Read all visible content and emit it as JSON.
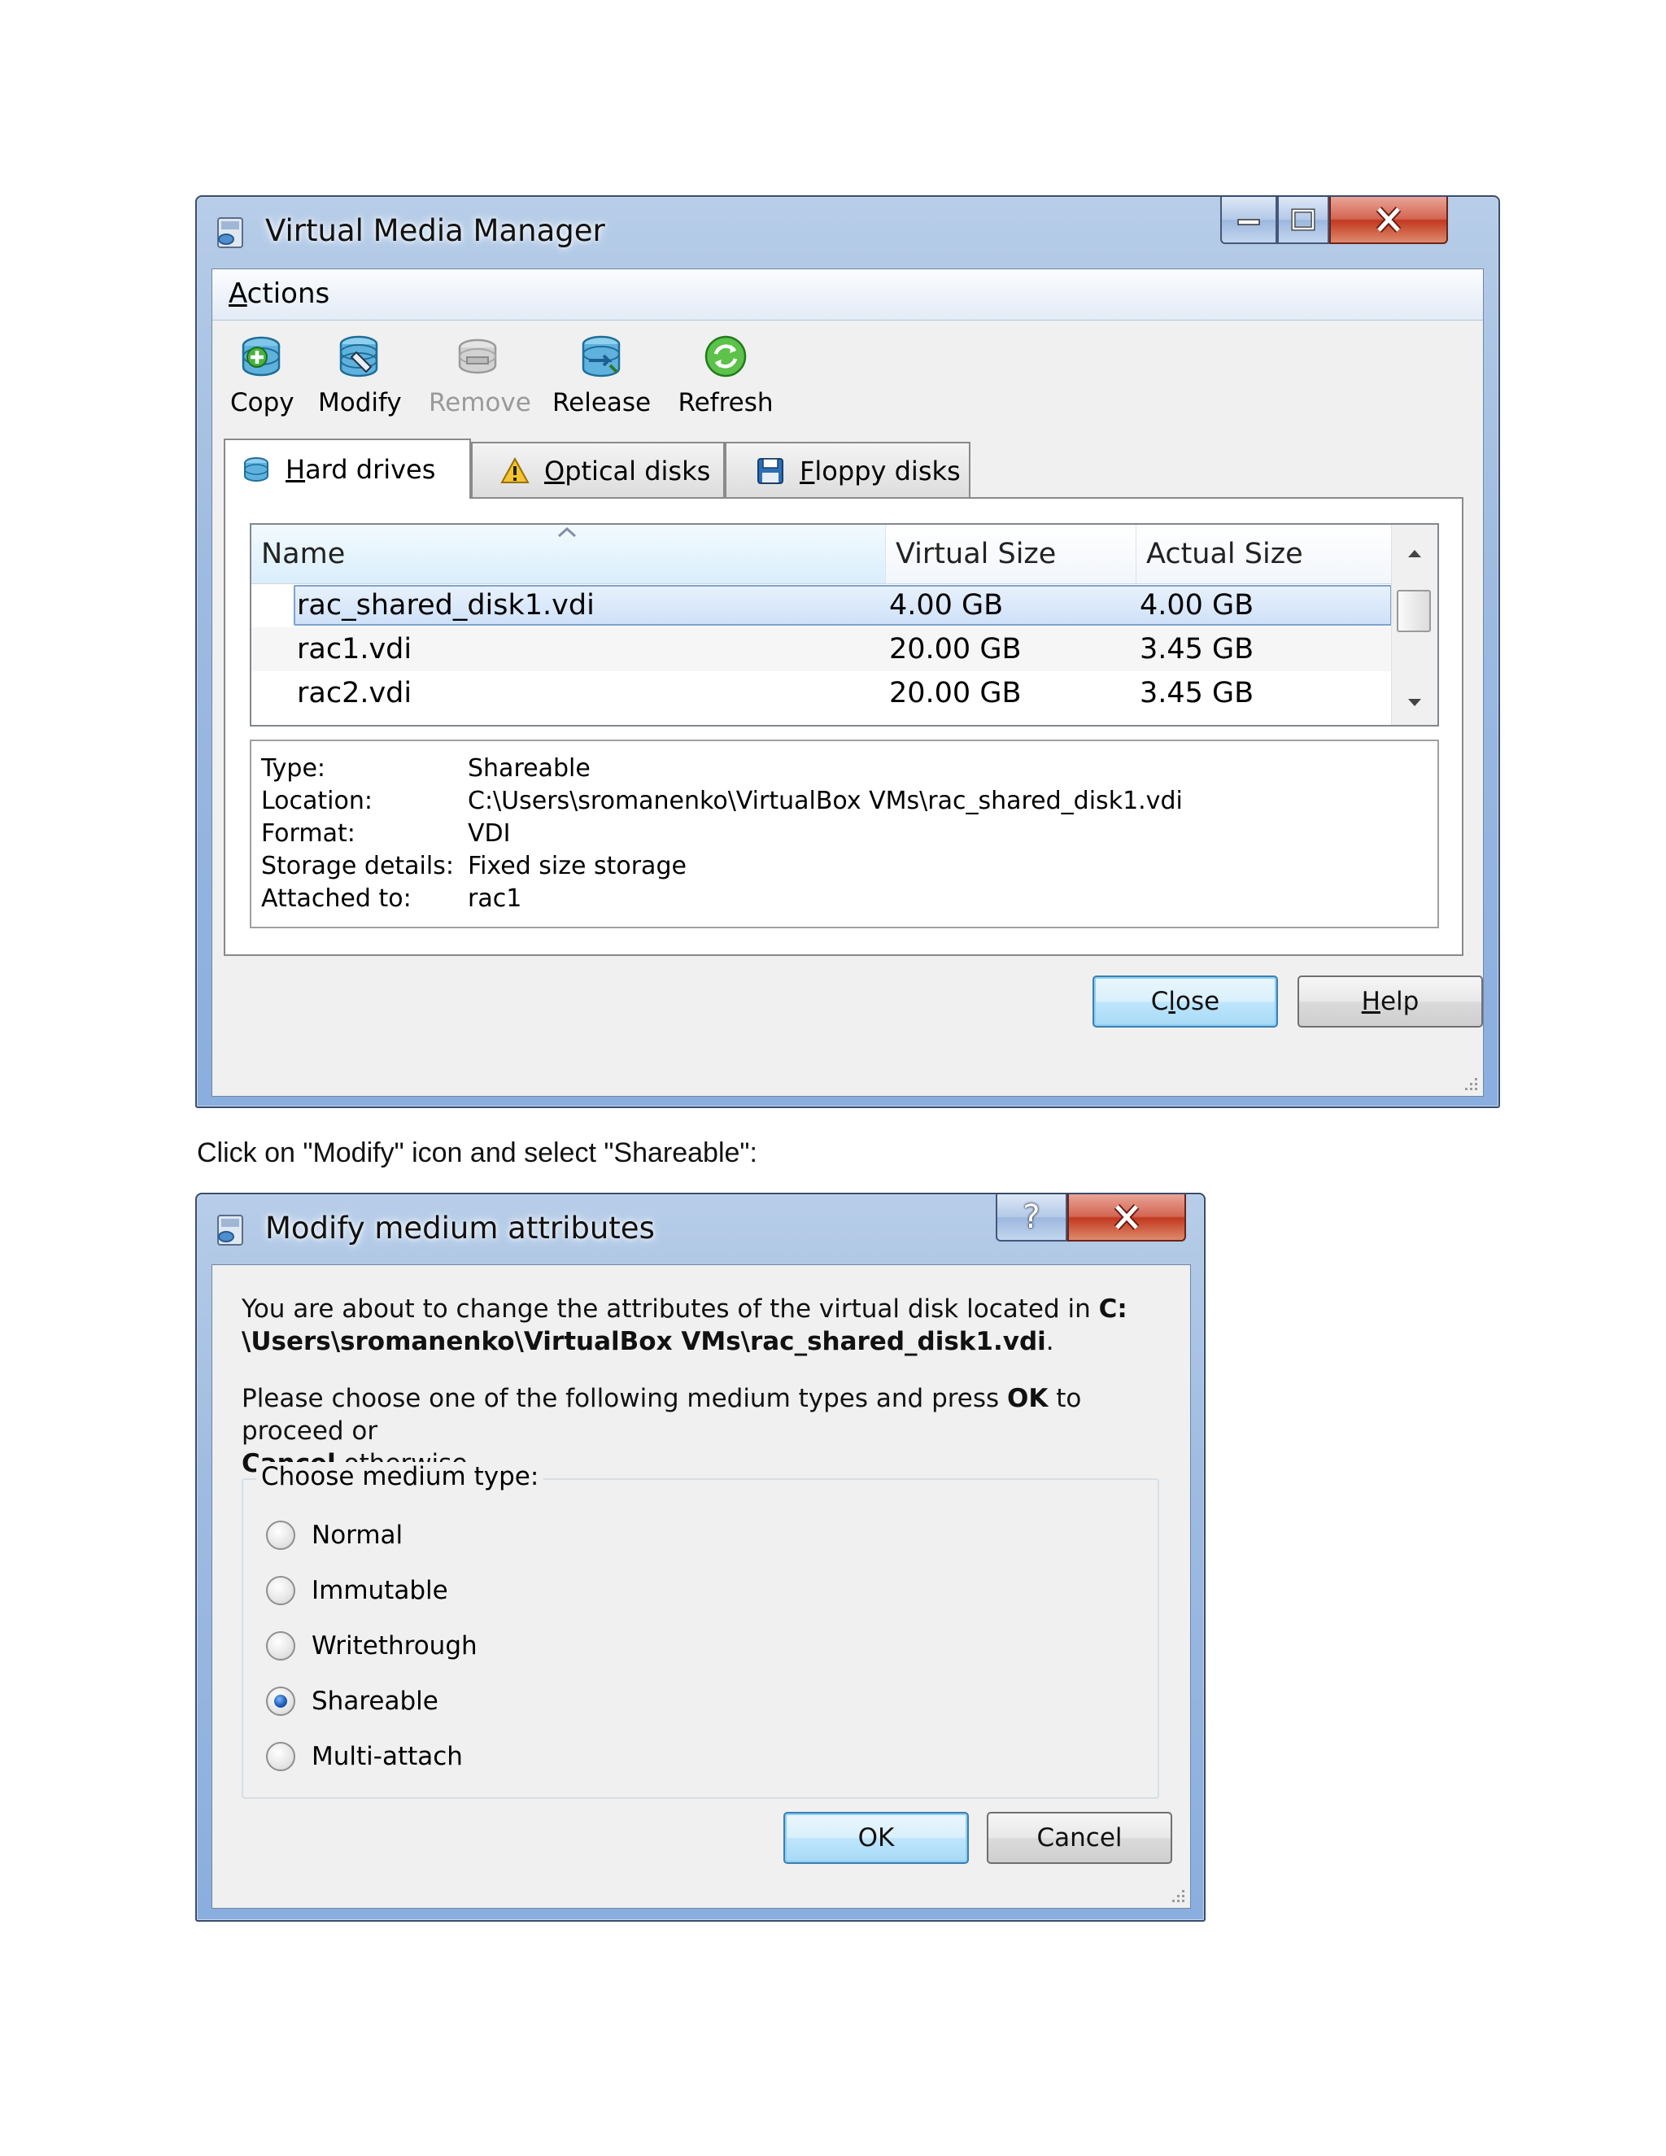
{
  "vmm": {
    "title": "Virtual Media Manager",
    "menu": {
      "actions_prefix": "A",
      "actions_rest": "ctions"
    },
    "toolbar": {
      "copy": "Copy",
      "modify": "Modify",
      "remove": "Remove",
      "release": "Release",
      "refresh": "Refresh"
    },
    "tabs": {
      "hard": {
        "u": "H",
        "rest": "ard drives"
      },
      "optical": {
        "u": "O",
        "rest": "ptical disks"
      },
      "floppy": {
        "u": "F",
        "rest": "loppy disks"
      }
    },
    "table": {
      "columns": [
        "Name",
        "Virtual Size",
        "Actual Size"
      ],
      "rows": [
        {
          "name": "rac_shared_disk1.vdi",
          "virtual": "4.00 GB",
          "actual": "4.00 GB",
          "selected": true
        },
        {
          "name": "rac1.vdi",
          "virtual": "20.00 GB",
          "actual": "3.45 GB",
          "selected": false
        },
        {
          "name": "rac2.vdi",
          "virtual": "20.00 GB",
          "actual": "3.45 GB",
          "selected": false
        }
      ]
    },
    "details": [
      {
        "k": "Type:",
        "v": "Shareable"
      },
      {
        "k": "Location:",
        "v": "C:\\Users\\sromanenko\\VirtualBox VMs\\rac_shared_disk1.vdi"
      },
      {
        "k": "Format:",
        "v": "VDI"
      },
      {
        "k": "Storage details:",
        "v": "Fixed size storage"
      },
      {
        "k": "Attached to:",
        "v": "rac1"
      }
    ],
    "buttons": {
      "close": {
        "a": "C",
        "u": "l",
        "b": "ose"
      },
      "help": {
        "u": "H",
        "b": "elp"
      }
    }
  },
  "caption": "Click on \"Modify\" icon and select \"Shareable\":",
  "modify": {
    "title": "Modify medium attributes",
    "help_glyph": "?",
    "msg1_a": "You are about to change the attributes of the virtual disk located in ",
    "msg1_path1": "C:",
    "msg1_path2": "\\Users\\sromanenko\\VirtualBox VMs\\rac_shared_disk1.vdi",
    "msg1_end": ".",
    "msg2_a": "Please choose one of the following medium types and press ",
    "msg2_ok": "OK",
    "msg2_b": " to proceed or",
    "msg2_cancel": "Cancel",
    "msg2_c": " otherwise.",
    "group_label": "Choose medium type:",
    "options": [
      "Normal",
      "Immutable",
      "Writethrough",
      "Shareable",
      "Multi-attach"
    ],
    "selected": "Shareable",
    "ok": "OK",
    "cancel": "Cancel"
  },
  "colors": {
    "frame": "#9fbbe0",
    "client": "#f0f0f0",
    "selection": "#cfe1f8",
    "close_red": "#c2391f"
  }
}
